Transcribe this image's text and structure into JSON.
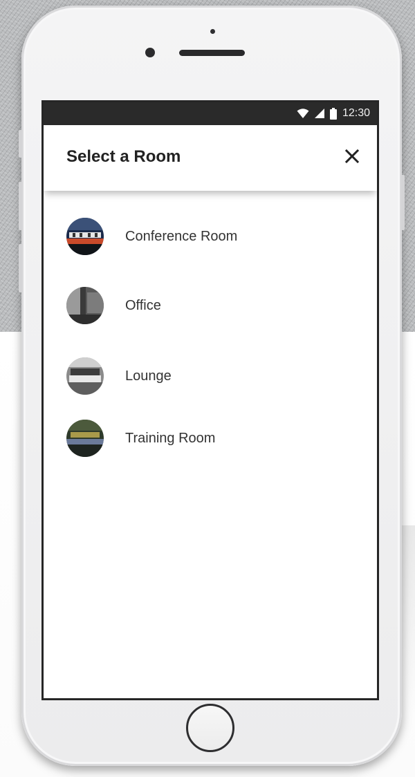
{
  "status_bar": {
    "time": "12:30",
    "wifi_icon": "wifi-icon",
    "signal_icon": "cell-signal-icon",
    "battery_icon": "battery-icon"
  },
  "dialog": {
    "title": "Select a Room",
    "close_icon": "close-icon"
  },
  "rooms": [
    {
      "label": "Conference Room",
      "thumbnail": "conference-room-photo"
    },
    {
      "label": "Office",
      "thumbnail": "office-photo"
    },
    {
      "label": "Lounge",
      "thumbnail": "lounge-photo"
    },
    {
      "label": "Training Room",
      "thumbnail": "training-room-photo"
    }
  ],
  "colors": {
    "status_bar_bg": "#2a2a2a",
    "title_text": "#222222",
    "item_text": "#333333",
    "screen_bg": "#ffffff"
  }
}
